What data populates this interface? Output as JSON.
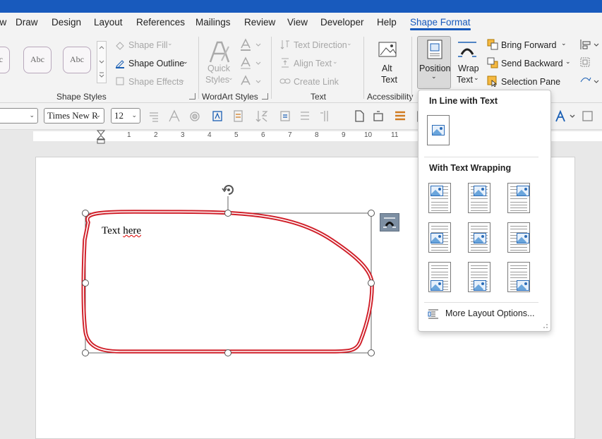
{
  "tabs": [
    "aw",
    "Draw",
    "Design",
    "Layout",
    "References",
    "Mailings",
    "Review",
    "View",
    "Developer",
    "Help",
    "Shape Format"
  ],
  "ribbon": {
    "shape_styles": {
      "style_sample": "Abc",
      "fill": "Shape Fill",
      "outline": "Shape Outline",
      "effects": "Shape Effects",
      "label": "Shape Styles"
    },
    "wordart": {
      "quick_styles_line1": "Quick",
      "quick_styles_line2": "Styles",
      "label": "WordArt Styles"
    },
    "text": {
      "direction": "Text Direction",
      "align": "Align Text",
      "link": "Create Link",
      "label": "Text"
    },
    "accessibility": {
      "alt_line1": "Alt",
      "alt_line2": "Text",
      "label": "Accessibility"
    },
    "arrange": {
      "position": "Position",
      "wrap_line1": "Wrap",
      "wrap_line2": "Text",
      "bring_forward": "Bring Forward",
      "send_backward": "Send Backward",
      "selection_pane": "Selection Pane"
    }
  },
  "toolbar2": {
    "font": "Times New R",
    "size": "12"
  },
  "ruler": [
    "1",
    "2",
    "3",
    "4",
    "5",
    "6",
    "7",
    "8",
    "9",
    "10",
    "11"
  ],
  "document": {
    "word1": "Text",
    "word2": "here"
  },
  "dropdown": {
    "inline_header": "In Line with Text",
    "wrapping_header": "With Text Wrapping",
    "more_options": "More Layout Options..."
  },
  "colors": {
    "accent": "#185abd",
    "shape_stroke": "#d0202a",
    "title_bar": "#185abd"
  }
}
